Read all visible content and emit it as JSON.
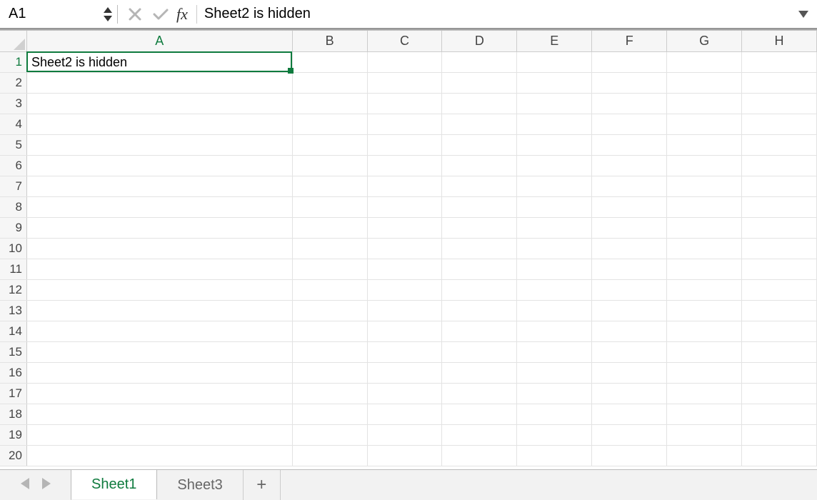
{
  "formula_bar": {
    "name_box": "A1",
    "cancel_icon": "✕",
    "confirm_icon": "✓",
    "fx_label": "fx",
    "formula_value": "Sheet2 is hidden"
  },
  "grid": {
    "col_widths": {
      "A": 372,
      "other": 105
    },
    "columns": [
      "A",
      "B",
      "C",
      "D",
      "E",
      "F",
      "G",
      "H"
    ],
    "row_count": 20,
    "active_cell": {
      "row": 1,
      "col": "A"
    },
    "cells": {
      "A1": "Sheet2 is hidden"
    }
  },
  "tabs": {
    "sheets": [
      {
        "name": "Sheet1",
        "active": true
      },
      {
        "name": "Sheet3",
        "active": false
      }
    ],
    "add_label": "+"
  }
}
